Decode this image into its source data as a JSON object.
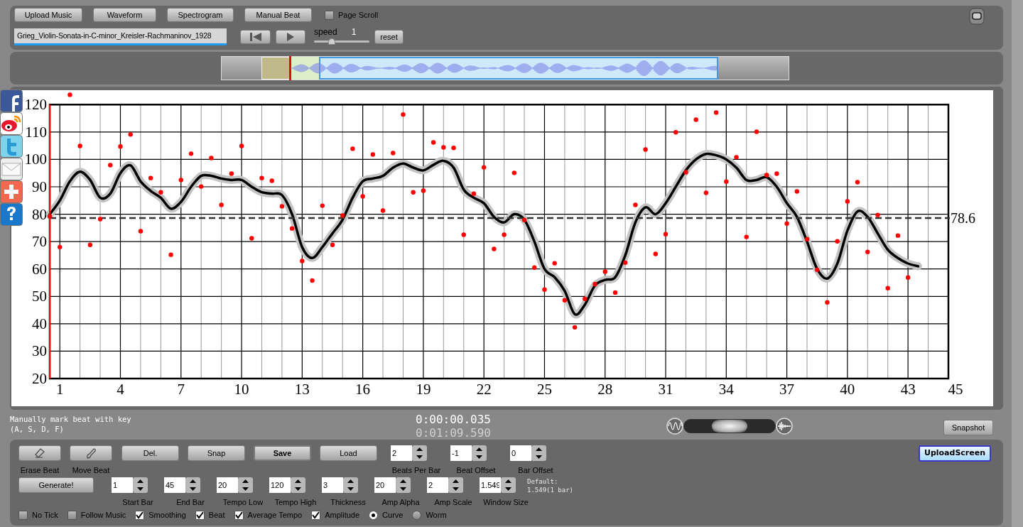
{
  "toolbar": {
    "buttons": [
      "Upload Music",
      "Waveform",
      "Spectrogram",
      "Manual Beat"
    ],
    "page_scroll": {
      "label": "Page Scroll",
      "checked": false
    },
    "file_name": "Grieg_Violin-Sonata-in-C-minor_Kreisler-Rachmaninov_1928",
    "speed": {
      "label": "speed",
      "value": "1",
      "level": 0.32
    },
    "reset": "reset"
  },
  "chart_data": {
    "type": "scatter",
    "grid": true,
    "xlim": [
      0.5,
      45
    ],
    "ylim": [
      20,
      125
    ],
    "xticks": [
      1,
      4,
      7,
      10,
      13,
      16,
      19,
      22,
      25,
      28,
      31,
      34,
      37,
      40,
      43,
      45
    ],
    "yticks": [
      20,
      30,
      40,
      50,
      60,
      70,
      80,
      90,
      100,
      110,
      120
    ],
    "x": [
      0.5,
      1,
      1.5,
      2,
      2.5,
      3,
      3.5,
      4,
      4.5,
      5,
      5.5,
      6,
      6.5,
      7,
      7.5,
      8,
      8.5,
      9,
      9.5,
      10,
      10.5,
      11,
      11.5,
      12,
      12.5,
      13,
      13.5,
      14,
      14.5,
      15,
      15.5,
      16,
      16.5,
      17,
      17.5,
      18,
      18.5,
      19,
      19.5,
      20,
      20.5,
      21,
      21.5,
      22,
      22.5,
      23,
      23.5,
      24,
      24.5,
      25,
      25.5,
      26,
      26.5,
      27,
      27.5,
      28,
      28.5,
      29,
      29.5,
      30,
      30.5,
      31,
      31.5,
      32,
      32.5,
      33,
      33.5,
      34,
      34.5,
      35,
      35.5,
      36,
      36.5,
      37,
      37.5,
      38,
      38.5,
      39,
      39.5,
      40,
      40.5,
      41,
      41.5,
      42,
      42.5,
      43,
      43.5
    ],
    "series": [
      {
        "color": "#ff0000",
        "values": [
          79.2,
          68,
          123.6,
          104.9,
          68.8,
          78.2,
          97.9,
          104.7,
          109.1,
          73.8,
          93.2,
          88,
          65.2,
          92.5,
          102.1,
          90.1,
          100.5,
          83.4,
          94.8,
          104.9,
          71.2,
          93.2,
          92.2,
          82.9,
          74.8,
          62.9,
          55.8,
          83.1,
          68.8,
          79.5,
          103.9,
          86.5,
          101.8,
          81.3,
          102.3,
          116.4,
          88,
          88.6,
          106.2,
          104.4,
          104.2,
          72.5,
          87.5,
          97.1,
          67.3,
          72.5,
          95.1,
          77.9,
          60.5,
          52.5,
          62.1,
          48.6,
          38.7,
          49.1,
          54.5,
          59,
          51.4,
          62.3,
          83.4,
          103.6,
          65.5,
          72.7,
          109.9,
          95.3,
          114.5,
          87.8,
          117.1,
          91.9,
          100.8,
          71.7,
          110.1,
          94.3,
          94.8,
          76.6,
          88.3,
          70.9,
          59.7,
          47.8,
          70.1,
          84.7,
          91.7,
          66.2,
          79.7,
          53,
          72.2,
          56.9,
          null
        ]
      },
      {
        "type": "line",
        "color": "#000000",
        "values": [
          80,
          85,
          92,
          95.5,
          92.5,
          86,
          87.5,
          95,
          97.8,
          92,
          88.5,
          86,
          82,
          84.5,
          90,
          94,
          94,
          93,
          92.5,
          92.5,
          90,
          88,
          87.5,
          87,
          80,
          68,
          64,
          68,
          73,
          78,
          86,
          92,
          93,
          94,
          97,
          98.5,
          97,
          96,
          98,
          99.5,
          97,
          89,
          86,
          84,
          79,
          77,
          80,
          78,
          70,
          60,
          57,
          52,
          43.5,
          47,
          54,
          56,
          57,
          65,
          77,
          82.5,
          80,
          84,
          90,
          96,
          100,
          102,
          101.5,
          100,
          97,
          92.5,
          92.5,
          93.5,
          90,
          84,
          79,
          70,
          60,
          56.5,
          62,
          74,
          81,
          79,
          73,
          67,
          64,
          62,
          61
        ]
      }
    ],
    "ref_lines": [
      {
        "axis": "y",
        "value": 78.6,
        "label": "78.6"
      }
    ]
  },
  "blend": {
    "level": 0.5
  },
  "status": {
    "hint": [
      "Manually mark beat with key",
      "(A, S, D, F)"
    ],
    "current_time": "0:00:00.035",
    "total_time": "0:01:09.590",
    "snapshot": "Snapshot"
  },
  "controls": {
    "tools": [
      {
        "kind": "eraser",
        "label": "Erase Beat"
      },
      {
        "kind": "brush",
        "label": "Move Beat"
      }
    ],
    "buttons": [
      {
        "label": "Del.",
        "focused": false
      },
      {
        "label": "Snap",
        "focused": false
      },
      {
        "label": "Save",
        "focused": true
      },
      {
        "label": "Load",
        "focused": false
      }
    ],
    "offsets": [
      {
        "label": "Beats Per Bar",
        "value": "2"
      },
      {
        "label": "Beat Offset",
        "value": "-1"
      },
      {
        "label": "Bar Offset",
        "value": "0"
      }
    ],
    "upload_screen": "UploadScreen",
    "generate": "Generate!",
    "params": [
      {
        "label": "Start Bar",
        "value": "1"
      },
      {
        "label": "End Bar",
        "value": "45"
      },
      {
        "label": "Tempo Low",
        "value": "20"
      },
      {
        "label": "Tempo High",
        "value": "120"
      },
      {
        "label": "Thickness",
        "value": "3"
      },
      {
        "label": "Amp Alpha",
        "value": "20"
      },
      {
        "label": "Amp Scale",
        "value": "2"
      },
      {
        "label": "Window Size",
        "value": "1.549"
      }
    ],
    "default_note": [
      "Default:",
      "1.549(1 bar)"
    ],
    "options": [
      {
        "kind": "checkbox",
        "label": "No Tick",
        "checked": false
      },
      {
        "kind": "checkbox",
        "label": "Follow Music",
        "checked": false
      },
      {
        "kind": "checkbox",
        "label": "Smoothing",
        "checked": true
      },
      {
        "kind": "checkbox",
        "label": "Beat",
        "checked": true
      },
      {
        "kind": "checkbox",
        "label": "Average Tempo",
        "checked": true
      },
      {
        "kind": "checkbox",
        "label": "Amplitude",
        "checked": true
      },
      {
        "kind": "radio",
        "label": "Curve",
        "selected": true
      },
      {
        "kind": "radio",
        "label": "Worm",
        "selected": false
      }
    ]
  }
}
